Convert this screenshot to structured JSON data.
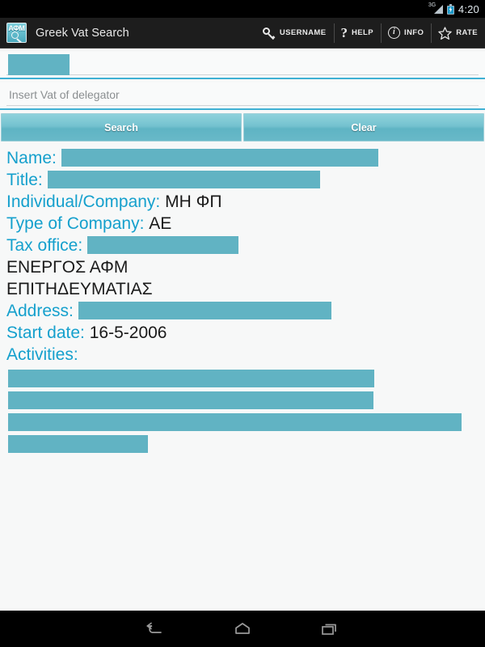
{
  "status_bar": {
    "network": "3G",
    "battery_icon": "battery-charging-icon",
    "time": "4:20"
  },
  "action_bar": {
    "app_icon_text": "ΑΦΜ",
    "title": "Greek Vat Search",
    "items": [
      {
        "icon": "key-icon",
        "label": "USERNAME"
      },
      {
        "icon": "question-mark-icon",
        "label": "HELP"
      },
      {
        "icon": "info-circle-icon",
        "label": "INFO"
      },
      {
        "icon": "star-icon",
        "label": "RATE"
      }
    ]
  },
  "form": {
    "vat_field": {
      "value": "",
      "redacted": true,
      "placeholder": ""
    },
    "delegator_field": {
      "value": "",
      "placeholder": "Insert Vat of delegator"
    },
    "search_button": "Search",
    "clear_button": "Clear"
  },
  "results": {
    "name": {
      "label": "Name:",
      "value": "",
      "redacted": true
    },
    "title": {
      "label": "Title:",
      "value": "",
      "redacted": true
    },
    "individual_company": {
      "label": "Individual/Company:",
      "value": "ΜΗ ΦΠ"
    },
    "type_of_company": {
      "label": "Type of Company:",
      "value": "ΑΕ"
    },
    "tax_office": {
      "label": "Tax office:",
      "value": "",
      "redacted": true
    },
    "status_line_1": "ΕΝΕΡΓΟΣ ΑΦΜ",
    "status_line_2": "ΕΠΙΤΗΔΕΥΜΑΤΙΑΣ",
    "address": {
      "label": "Address:",
      "value": "",
      "redacted": true
    },
    "start_date": {
      "label": "Start date:",
      "value": "16-5-2006"
    },
    "activities": {
      "label": "Activities:",
      "redacted_lines": 4
    }
  },
  "nav_bar": {
    "back": "back-icon",
    "home": "home-icon",
    "recents": "recents-icon"
  },
  "colors": {
    "accent_cyan": "#15a0cd",
    "redaction_teal": "#61b3c3",
    "field_underline": "#3fb0d4",
    "action_bar_bg": "#1d1d1d",
    "page_bg": "#f7f8f8"
  }
}
